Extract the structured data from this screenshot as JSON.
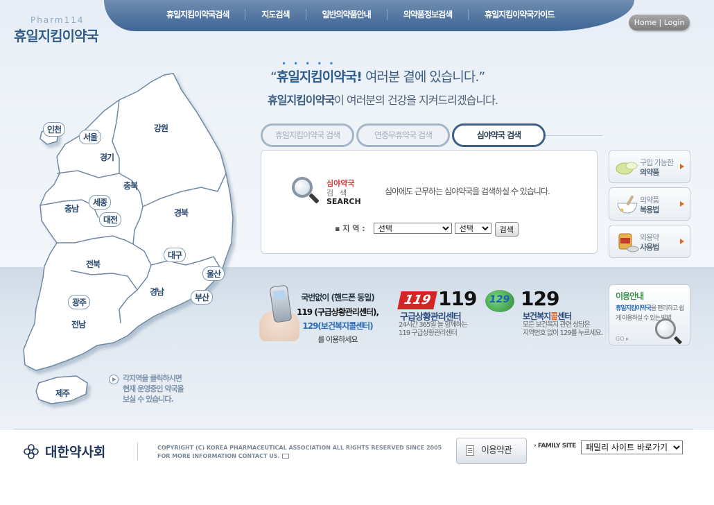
{
  "logo": {
    "en": "Pharm114",
    "ko": "휴일지킴이약국"
  },
  "nav": {
    "items": [
      "휴일지킴이약국검색",
      "지도검색",
      "일반의약품안내",
      "의약품정보검색",
      "휴일지킴이약국가이드"
    ]
  },
  "home_login": "Home | Login",
  "headline": {
    "open_quote": "“",
    "brand": "휴일지킴이약국",
    "excl": "!",
    "rest": "여러분 곁에 있습니다.”",
    "line2_brand": "휴일지킴이약국",
    "line2_rest": "이 여러분의 건강을 지켜드리겠습니다."
  },
  "tabs": [
    {
      "label": "휴일지킴이약국 검색",
      "active": false
    },
    {
      "label": "연중무휴약국 검색",
      "active": false
    },
    {
      "label": "심야약국 검색",
      "active": true
    }
  ],
  "search_panel": {
    "logo_red": "심야약국",
    "logo_grey": "검색",
    "logo_eng": "SEARCH",
    "description": "심야에도 근무하는 심야약국을 검색하실 수 있습니다.",
    "region_label": "지 역 :",
    "select1": "선택",
    "select2": "선택",
    "search_button": "검색"
  },
  "side_buttons": [
    {
      "line1": "구입 가능한",
      "line2": "의약품",
      "icon": "pill-icon"
    },
    {
      "line1": "의약품",
      "line2": "복용법",
      "icon": "mortar-icon"
    },
    {
      "line1": "외용약",
      "line2": "사용법",
      "icon": "ointment-icon"
    }
  ],
  "map": {
    "regions": [
      "인천",
      "서울",
      "강원",
      "경기",
      "충북",
      "충남",
      "세종",
      "대전",
      "경북",
      "대구",
      "전북",
      "울산",
      "경남",
      "광주",
      "부산",
      "전남",
      "제주"
    ],
    "hint": [
      "각지역을 클릭하시면",
      "현재 운영중인 약국을",
      "보실 수 있습니다."
    ]
  },
  "emergency": {
    "line1": "국번없이 (핸드폰 동일)",
    "line2": "119 (구급상황관리센터),",
    "line3": "129(보건복지콜센터)",
    "line4": "를 이용하세요",
    "e119_logo": "119",
    "e119_number": "119",
    "e119_title": "구급상황관리센터",
    "e119_sub1": "24시간 365일 늘 함께하는",
    "e119_sub2": "119 구급상황관리센터",
    "e129_logo": "129",
    "e129_number": "129",
    "e129_title_a": "보건복지",
    "e129_title_b": "콜",
    "e129_title_c": "센터",
    "e129_sub1": "모든 보건복지 관련 상담은",
    "e129_sub2": "지역번호 없이 129를 누르세요."
  },
  "guide": {
    "title": "이용안내",
    "brand": "휴일지킴이약국",
    "text": "을 편리하고 쉽게 이용하실 수 있는 방법",
    "go": "GO"
  },
  "footer": {
    "org": "대한약사회",
    "copyright1": "COPYRIGHT (C) KOREA PHARMACEUTICAL ASSOCIATION ALL RIGHTS RESERVED SINCE 2005",
    "copyright2": "FOR MORE INFORMATION CONTACT US.",
    "terms": "이용약관",
    "family_label": "FAMILY SITE",
    "family_select": "패밀리 사이트 바로가기"
  },
  "colors": {
    "nav_bg": "#3d6595",
    "active_tab_border": "#3f5f85",
    "accent_red": "#d42424",
    "accent_orange": "#e06a26"
  }
}
